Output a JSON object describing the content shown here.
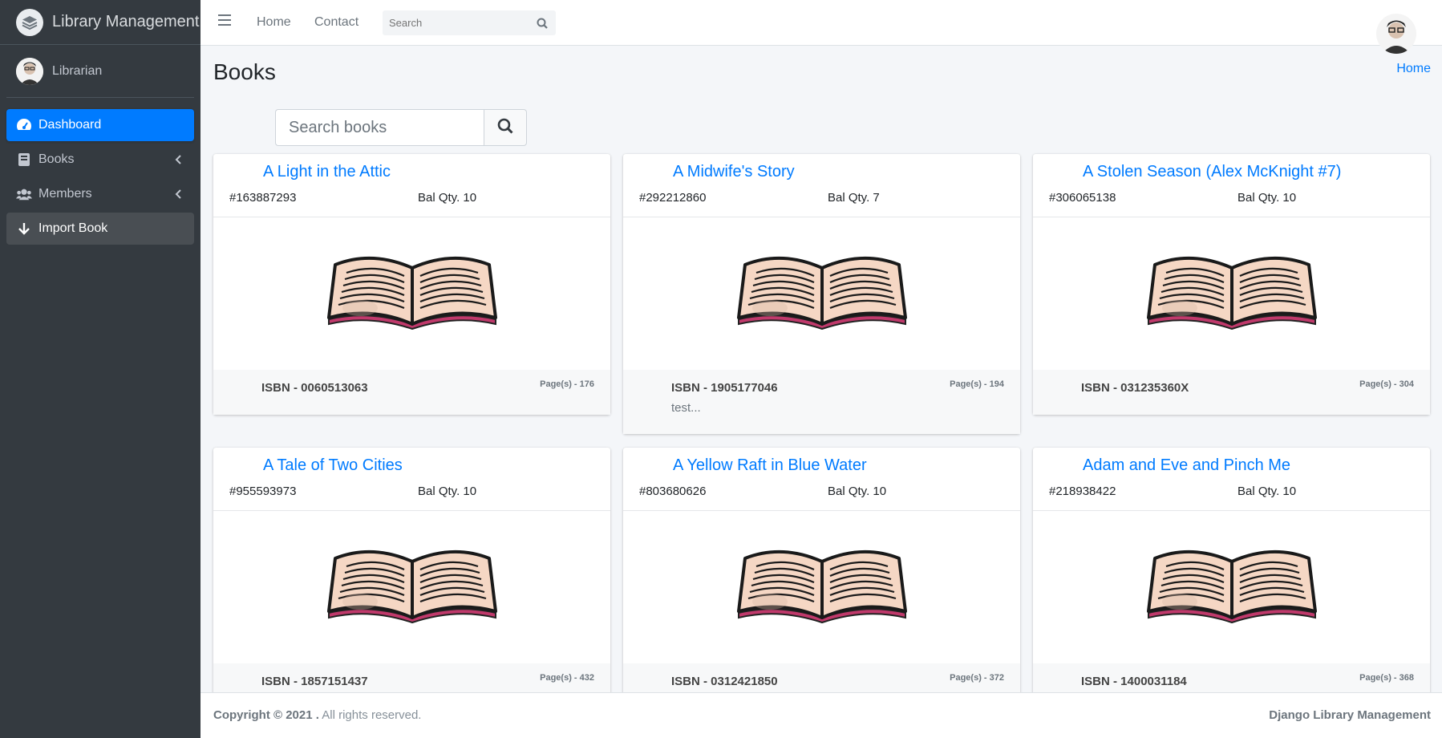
{
  "brand": {
    "title": "Library Management",
    "logo_icon": "layers-icon"
  },
  "user": {
    "name": "Librarian"
  },
  "sidebar": {
    "items": [
      {
        "label": "Dashboard",
        "icon": "tachometer-icon"
      },
      {
        "label": "Books",
        "icon": "book-icon"
      },
      {
        "label": "Members",
        "icon": "users-icon"
      },
      {
        "label": "Import Book",
        "icon": "arrow-down-icon"
      }
    ]
  },
  "topnav": {
    "links": [
      "Home",
      "Contact"
    ],
    "search_placeholder": "Search"
  },
  "page": {
    "title": "Books",
    "breadcrumb": "Home",
    "search_placeholder": "Search books"
  },
  "books": [
    {
      "title": "A Light in the Attic",
      "id": "#163887293",
      "qty": "Bal Qty. 10",
      "isbn": "ISBN - 0060513063",
      "pages": "Page(s) - 176",
      "desc": ""
    },
    {
      "title": "A Midwife's Story",
      "id": "#292212860",
      "qty": "Bal Qty. 7",
      "isbn": "ISBN - 1905177046",
      "pages": "Page(s) - 194",
      "desc": "test..."
    },
    {
      "title": "A Stolen Season (Alex McKnight #7)",
      "id": "#306065138",
      "qty": "Bal Qty. 10",
      "isbn": "ISBN - 031235360X",
      "pages": "Page(s) - 304",
      "desc": ""
    },
    {
      "title": "A Tale of Two Cities",
      "id": "#955593973",
      "qty": "Bal Qty. 10",
      "isbn": "ISBN - 1857151437",
      "pages": "Page(s) - 432",
      "desc": ""
    },
    {
      "title": "A Yellow Raft in Blue Water",
      "id": "#803680626",
      "qty": "Bal Qty. 10",
      "isbn": "ISBN - 0312421850",
      "pages": "Page(s) - 372",
      "desc": ""
    },
    {
      "title": "Adam and Eve and Pinch Me",
      "id": "#218938422",
      "qty": "Bal Qty. 10",
      "isbn": "ISBN - 1400031184",
      "pages": "Page(s) - 368",
      "desc": ""
    }
  ],
  "footer": {
    "copyright": "Copyright © 2021 .",
    "rights": "All rights reserved.",
    "app": "Django Library Management"
  },
  "colors": {
    "primary": "#007bff",
    "sidebar": "#343a40",
    "background": "#f4f6f9"
  }
}
